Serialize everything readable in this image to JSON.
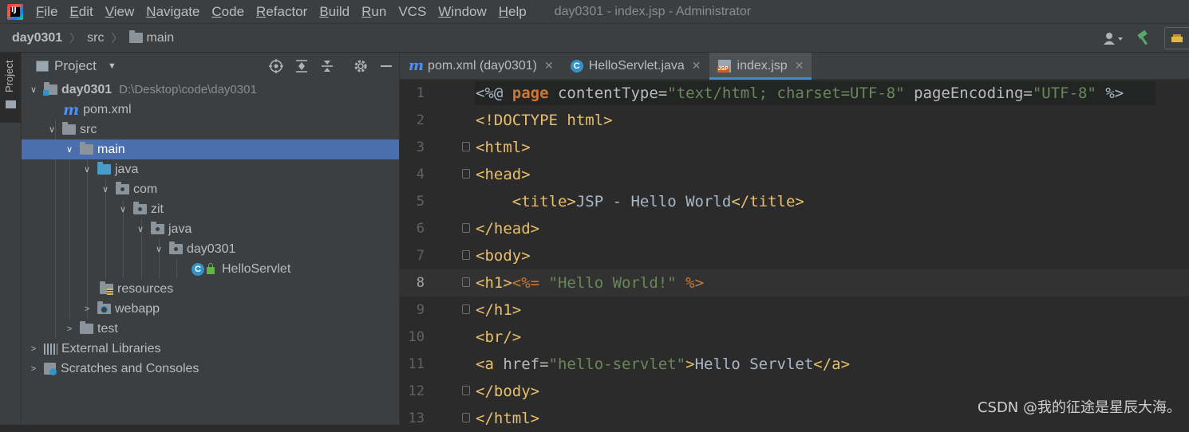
{
  "menu": {
    "items": [
      {
        "u": "F",
        "rest": "ile"
      },
      {
        "u": "E",
        "rest": "dit"
      },
      {
        "u": "V",
        "rest": "iew"
      },
      {
        "u": "N",
        "rest": "avigate"
      },
      {
        "u": "C",
        "rest": "ode"
      },
      {
        "u": "R",
        "rest": "efactor"
      },
      {
        "u": "B",
        "rest": "uild"
      },
      {
        "u": "R",
        "rest": "un"
      },
      {
        "u": "",
        "rest": "VCS"
      },
      {
        "u": "W",
        "rest": "indow"
      },
      {
        "u": "H",
        "rest": "elp"
      }
    ],
    "window_title": "day0301 - index.jsp - Administrator"
  },
  "nav": {
    "crumbs": [
      "day0301",
      "src",
      "main"
    ]
  },
  "tool_strip": {
    "project_label": "Project"
  },
  "project": {
    "title": "Project",
    "root_name": "day0301",
    "root_path": "D:\\Desktop\\code\\day0301",
    "items": {
      "pom": "pom.xml",
      "src": "src",
      "main": "main",
      "java": "java",
      "com": "com",
      "zit": "zit",
      "java2": "java",
      "day0301": "day0301",
      "helloservlet": "HelloServlet",
      "resources": "resources",
      "webapp": "webapp",
      "test": "test",
      "external_libraries": "External Libraries",
      "scratches": "Scratches and Consoles"
    }
  },
  "tabs": [
    {
      "label": "pom.xml (day0301)",
      "icon": "maven-icon",
      "active": false
    },
    {
      "label": "HelloServlet.java",
      "icon": "class-icon",
      "active": false
    },
    {
      "label": "index.jsp",
      "icon": "jsp-file-icon",
      "active": true
    }
  ],
  "editor": {
    "current_line": 8,
    "lines": [
      {
        "n": "1"
      },
      {
        "n": "2"
      },
      {
        "n": "3"
      },
      {
        "n": "4"
      },
      {
        "n": "5"
      },
      {
        "n": "6"
      },
      {
        "n": "7"
      },
      {
        "n": "8"
      },
      {
        "n": "9"
      },
      {
        "n": "10"
      },
      {
        "n": "11"
      },
      {
        "n": "12"
      },
      {
        "n": "13"
      }
    ],
    "code": {
      "l1_open": "<%@ ",
      "l1_page": "page",
      "l1_attr1": " contentType=",
      "l1_val1": "\"text/html; charset=UTF-8\"",
      "l1_attr2": " pageEncoding=",
      "l1_val2": "\"UTF-8\"",
      "l1_close": " %>",
      "l2_doctype": "<!DOCTYPE html>",
      "l3": "<html>",
      "l4": "<head>",
      "l5_indent": "    ",
      "l5_open": "<title>",
      "l5_text": "JSP - Hello World",
      "l5_close": "</title>",
      "l6": "</head>",
      "l7": "<body>",
      "l8_h1": "<h1>",
      "l8_open": "<%= ",
      "l8_str": "\"Hello World!\"",
      "l8_close": " %>",
      "l9": "</h1>",
      "l10": "<br/>",
      "l11_open": "<a",
      "l11_attr": " href=",
      "l11_val": "\"hello-servlet\"",
      "l11_gt": ">",
      "l11_text": "Hello Servlet",
      "l11_close": "</a>",
      "l12": "</body>",
      "l13": "</html>"
    }
  },
  "watermark": "CSDN @我的征途是星辰大海。",
  "colors": {
    "background": "#2b2b2b",
    "panel": "#3c3f41",
    "selection": "#4b6eaf",
    "tag": "#e8bf6a",
    "string": "#6a8759",
    "keyword": "#cc7832"
  }
}
